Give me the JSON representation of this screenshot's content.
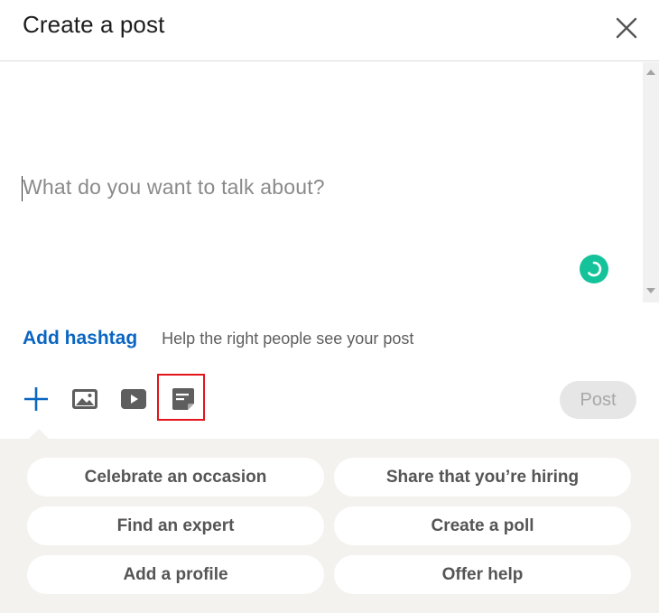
{
  "dialog": {
    "title": "Create a post"
  },
  "editor": {
    "placeholder": "What do you want to talk about?"
  },
  "hashtag": {
    "add_label": "Add hashtag",
    "help_text": "Help the right people see your post"
  },
  "toolbar": {
    "icons": [
      "plus-icon",
      "photo-icon",
      "video-icon",
      "document-icon"
    ],
    "post_label": "Post"
  },
  "suggestions": {
    "items": [
      "Celebrate an occasion",
      "Share that you’re hiring",
      "Find an expert",
      "Create a poll",
      "Add a profile",
      "Offer help"
    ]
  },
  "colors": {
    "accent": "#0a66c2",
    "highlight": "#e3151b",
    "grammarly": "#15c39a",
    "panel": "#f3f2ef"
  }
}
